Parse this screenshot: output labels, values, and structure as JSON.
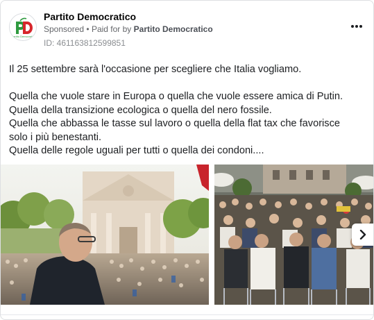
{
  "post": {
    "page_name": "Partito Democratico",
    "sponsored": "Sponsored",
    "paid_for_prefix": "Paid for by",
    "paid_for_by": "Partito Democratico",
    "separator": "•",
    "ad_id": "ID: 461163812599851",
    "body_text": "Il 25 settembre sarà l'occasione per scegliere che Italia vogliamo.\n\nQuella che vuole stare in Europa o quella che vuole essere amica di Putin.\nQuella della transizione ecologica o quella del nero fossile.\nQuella che abbassa le tasse sul lavoro o quella della flat tax che favorisce solo i più benestanti.\nQuella delle regole uguali per tutti o quella dei condoni....",
    "avatar_logo_text": "PD",
    "avatar_caption": "Partito Democratico"
  },
  "icons": {
    "more": "more-options-icon",
    "next": "chevron-right-icon"
  },
  "colors": {
    "logo_green": "#2e9a3f",
    "logo_red": "#d7262b",
    "meta_text": "#65676b"
  }
}
